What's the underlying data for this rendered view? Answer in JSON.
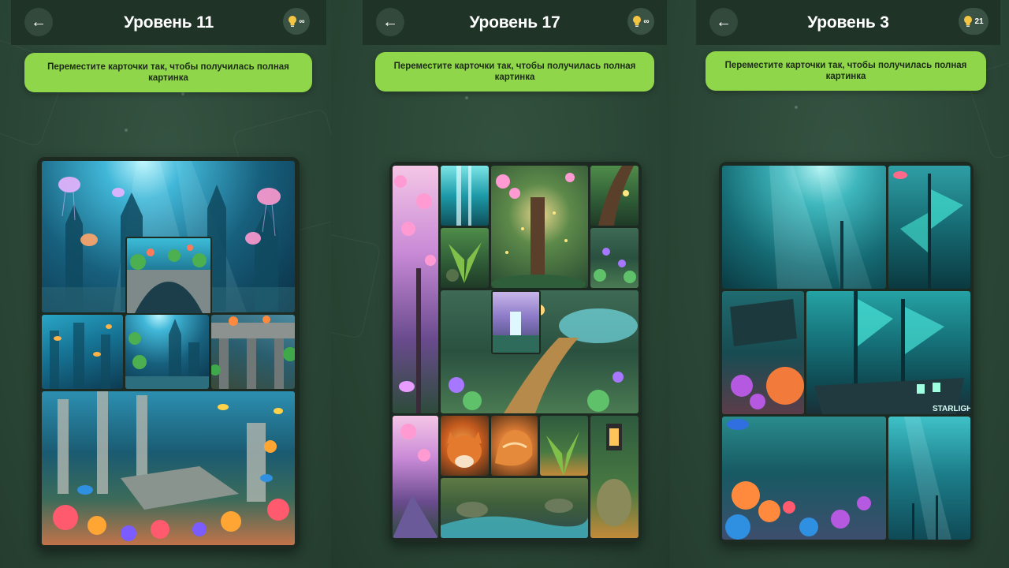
{
  "screens": [
    {
      "title": "Уровень 11",
      "hints": "∞",
      "instruction": "Переместите карточки так, чтобы получилась полная картинка",
      "puzzle": "underwater-city"
    },
    {
      "title": "Уровень 17",
      "hints": "∞",
      "instruction": "Переместите карточки так, чтобы получилась полная картинка",
      "puzzle": "enchanted-forest"
    },
    {
      "title": "Уровень 3",
      "hints": "21",
      "instruction": "Переместите карточки так, чтобы получилась полная картинка",
      "puzzle": "sunken-ship",
      "ship_name": "STARLIGH"
    }
  ],
  "icons": {
    "back": "arrow-left-icon",
    "hint": "lightbulb-icon"
  },
  "colors": {
    "banner": "#8fd64a",
    "header": "#1f3327",
    "background": "#2a4435",
    "hint_bulb": "#f4c542"
  }
}
